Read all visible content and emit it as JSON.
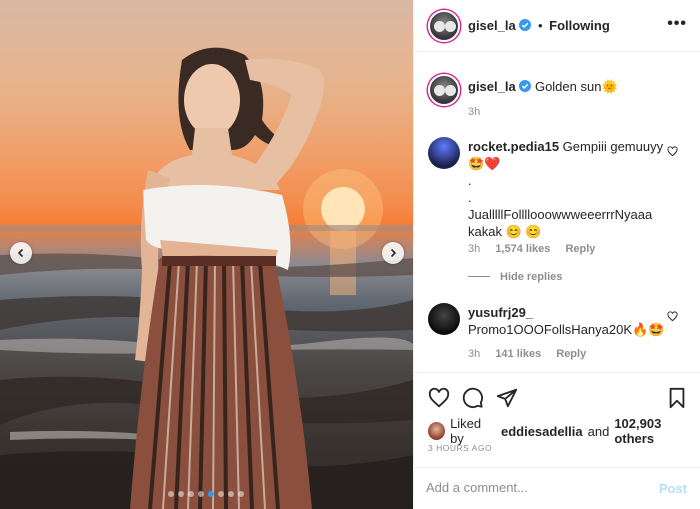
{
  "post": {
    "author": "gisel_la",
    "separator": "•",
    "follow_state": "Following",
    "more_label": "•••"
  },
  "caption": {
    "author": "gisel_la",
    "text": "Golden sun",
    "emoji": "🌞",
    "time": "3h"
  },
  "comments": [
    {
      "author": "rocket.pedia15",
      "text": "Gempiii gemuuyy",
      "emoji": "🤩❤️",
      "lines": [
        ".",
        ".",
        "JualllllFollllooowwweeerrrNyaaa",
        "kakak 😊 😊"
      ],
      "time": "3h",
      "likes": "1,574 likes",
      "reply": "Reply",
      "replies_toggle": "Hide replies"
    },
    {
      "author": "yusufrj29_",
      "text": "Promo1OOOFollsHanya20K",
      "emoji": "🔥🤩",
      "time": "3h",
      "likes": "141 likes",
      "reply": "Reply"
    }
  ],
  "likes": {
    "prefix": "Liked by",
    "user": "eddiesadellia",
    "and": "and",
    "others": "102,903 others"
  },
  "posted_ago": "3 HOURS AGO",
  "comment_box": {
    "placeholder": "Add a comment...",
    "post_label": "Post"
  },
  "carousel": {
    "slide_count": 8,
    "active_slide": 5
  }
}
